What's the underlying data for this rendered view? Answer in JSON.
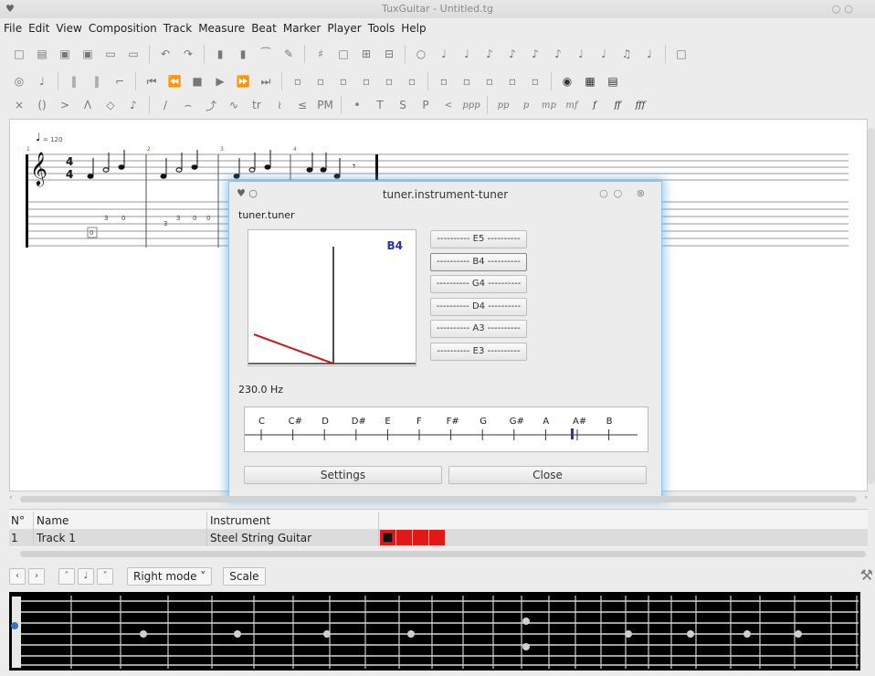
{
  "window": {
    "title": "TuxGuitar - Untitled.tg"
  },
  "menu": [
    "File",
    "Edit",
    "View",
    "Composition",
    "Track",
    "Measure",
    "Beat",
    "Marker",
    "Player",
    "Tools",
    "Help"
  ],
  "toolbar_icons": {
    "row1": [
      "new-icon",
      "open-icon",
      "save-icon",
      "save-as-icon",
      "print-icon",
      "print-preview-icon",
      "undo-icon",
      "redo-icon",
      "add-measure-icon",
      "remove-measure-icon",
      "tie-icon",
      "edit-icon",
      "key-icon",
      "cursor-icon",
      "zoom-in-icon",
      "zoom-out-icon",
      "whole-note-icon",
      "half-note-icon",
      "quarter-note-icon",
      "eighth-note-icon",
      "sixteenth-note-icon",
      "thirtysecond-note-icon",
      "sixtyfourth-note-icon",
      "dotted-icon",
      "double-dotted-icon",
      "tuplet-icon",
      "chord-icon",
      "chord-dropdown-icon"
    ],
    "row2": [
      "metronome-icon",
      "tempo-icon",
      "repeat-open-icon",
      "repeat-close-icon",
      "alternative-icon",
      "first-icon",
      "previous-icon",
      "stop-icon",
      "play-icon",
      "next-icon",
      "last-icon",
      "mixer-1-icon",
      "mixer-2-icon",
      "mixer-3-icon",
      "mixer-4-icon",
      "mixer-5-icon",
      "mixer-6-icon",
      "layout-1-icon",
      "layout-2-icon",
      "layout-3-icon",
      "layout-4-icon",
      "layout-5-icon",
      "tuner-icon",
      "matrix-icon",
      "fretboard-icon"
    ],
    "row3": [
      "dead-note-icon",
      "ghost-note-icon",
      "accent-icon",
      "heavy-accent-icon",
      "harmonic-icon",
      "grace-icon",
      "slide-icon",
      "hammer-icon",
      "bend-icon",
      "vibrato-icon",
      "trill-icon",
      "tremolo-icon",
      "fade-icon",
      "palm-mute-icon",
      "staccato-icon",
      "tapping-icon",
      "slapping-icon",
      "popping-icon",
      "fade-in-icon",
      "dynamic-ppp-icon",
      "dynamic-pp-icon",
      "dynamic-p-icon",
      "dynamic-mp-icon",
      "dynamic-mf-icon",
      "dynamic-f-icon",
      "dynamic-ff-icon",
      "dynamic-fff-icon"
    ]
  },
  "score": {
    "tempo": "= 120",
    "time_sig": [
      "4",
      "4"
    ],
    "measure_numbers": [
      "1",
      "2",
      "3",
      "4"
    ],
    "tab_numbers": [
      "3",
      "0",
      "0",
      "3",
      "0",
      "3",
      "0"
    ]
  },
  "tuner": {
    "title": "tuner.instrument-tuner",
    "subtitle": "tuner.tuner",
    "detected_note": "B4",
    "needle_value": 0,
    "strings": [
      "---------- E5 ----------",
      "---------- B4 ----------",
      "---------- G4 ----------",
      "---------- D4 ----------",
      "---------- A3 ----------",
      "---------- E3 ----------"
    ],
    "frequency": "230.0 Hz",
    "scale_notes": [
      "C",
      "C#",
      "D",
      "D#",
      "E",
      "F",
      "F#",
      "G",
      "G#",
      "A",
      "A#",
      "B"
    ],
    "marker_note": "A#",
    "settings_label": "Settings",
    "close_label": "Close"
  },
  "track_table": {
    "headers": {
      "number": "N°",
      "name": "Name",
      "instrument": "Instrument"
    },
    "rows": [
      {
        "number": "1",
        "name": "Track 1",
        "instrument": "Steel String Guitar"
      }
    ]
  },
  "fretboard_toolbar": {
    "mode": "Right mode",
    "scale_label": "Scale"
  },
  "colors": {
    "accent_blue": "#2433b8",
    "track_red": "#e01818",
    "needle_red": "#cc1a1a"
  }
}
